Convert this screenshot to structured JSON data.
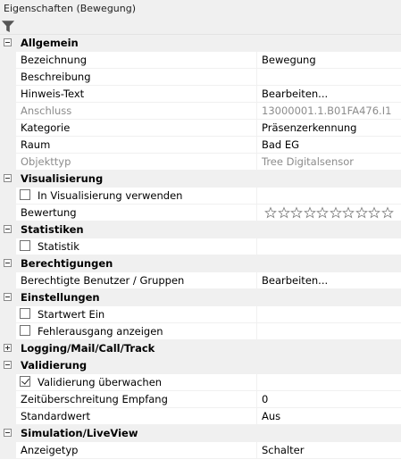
{
  "window": {
    "title": "Eigenschaften (Bewegung)"
  },
  "toolbar": {
    "filter_icon": "filter-icon"
  },
  "rating": {
    "stars_total": 10,
    "stars_filled": 0
  },
  "rows": {
    "allgemein": {
      "label": "Allgemein"
    },
    "bezeichnung": {
      "label": "Bezeichnung",
      "value": "Bewegung"
    },
    "beschreibung": {
      "label": "Beschreibung",
      "value": ""
    },
    "hinweis": {
      "label": "Hinweis-Text",
      "value": "Bearbeiten..."
    },
    "anschluss": {
      "label": "Anschluss",
      "value": "13000001.1.B01FA476.I1"
    },
    "kategorie": {
      "label": "Kategorie",
      "value": "Präsenzerkennung"
    },
    "raum": {
      "label": "Raum",
      "value": "Bad EG"
    },
    "objekttyp": {
      "label": "Objekttyp",
      "value": "Tree Digitalsensor"
    },
    "visualisierung": {
      "label": "Visualisierung"
    },
    "in_visu": {
      "label": "In Visualisierung verwenden"
    },
    "bewertung": {
      "label": "Bewertung"
    },
    "statistiken": {
      "label": "Statistiken"
    },
    "statistik": {
      "label": "Statistik"
    },
    "berechtigungen": {
      "label": "Berechtigungen"
    },
    "ber_benutzer": {
      "label": "Berechtigte Benutzer / Gruppen",
      "value": "Bearbeiten..."
    },
    "einstellungen": {
      "label": "Einstellungen"
    },
    "startwert": {
      "label": "Startwert Ein"
    },
    "fehlerausgang": {
      "label": "Fehlerausgang anzeigen"
    },
    "logging": {
      "label": "Logging/Mail/Call/Track"
    },
    "validierung": {
      "label": "Validierung"
    },
    "val_ueberwachen": {
      "label": "Validierung überwachen"
    },
    "zeitueberschreitung": {
      "label": "Zeitüberschreitung Empfang",
      "value": "0"
    },
    "standardwert": {
      "label": "Standardwert",
      "value": "Aus"
    },
    "simulation": {
      "label": "Simulation/LiveView"
    },
    "anzeigetyp": {
      "label": "Anzeigetyp",
      "value": "Schalter"
    }
  }
}
